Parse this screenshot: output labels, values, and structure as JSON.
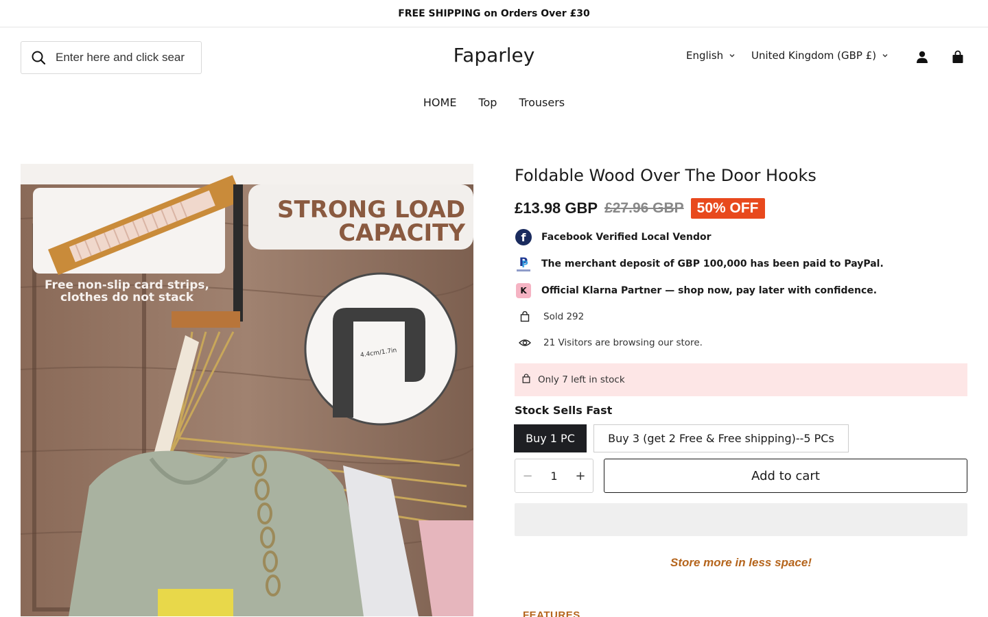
{
  "announcement": "FREE SHIPPING on Orders Over £30",
  "search": {
    "placeholder": "Enter here and click sear"
  },
  "brand": "Faparley",
  "header": {
    "language": "English",
    "country": "United Kingdom (GBP £)"
  },
  "nav": [
    {
      "label": "HOME"
    },
    {
      "label": "Top"
    },
    {
      "label": "Trousers"
    }
  ],
  "product": {
    "title": "Foldable Wood Over The Door Hooks",
    "price": "£13.98 GBP",
    "compare_price": "£27.96 GBP",
    "discount_badge": "50% OFF",
    "image_text": {
      "headline_1": "STRONG LOAD",
      "headline_2": "CAPACITY",
      "note_1": "Free non-slip card strips,",
      "note_2": "clothes do not stack",
      "dimension": "4.4cm/1.7in"
    },
    "trust": [
      {
        "icon": "facebook-icon",
        "text": "Facebook Verified Local Vendor"
      },
      {
        "icon": "paypal-icon",
        "text": "The merchant deposit of GBP 100,000 has been paid to PayPal."
      },
      {
        "icon": "klarna-icon",
        "text": "Official Klarna Partner — shop now, pay later with confidence."
      }
    ],
    "sold": "Sold 292",
    "visitors": "21 Visitors are browsing our store.",
    "stock_notice": "Only 7 left in stock",
    "stock_heading": "Stock Sells Fast",
    "options": [
      {
        "label": "Buy 1 PC",
        "selected": true
      },
      {
        "label": "Buy 3 (get 2 Free & Free shipping)--5 PCs",
        "selected": false
      }
    ],
    "quantity": "1",
    "add_to_cart": "Add to cart",
    "tagline": "Store more in less space!",
    "features_heading": "FEATURES"
  },
  "colors": {
    "badge": "#e8491d",
    "accent_text": "#b5651d",
    "stock_banner": "#fde6e6",
    "selected_option": "#1e1f23"
  }
}
